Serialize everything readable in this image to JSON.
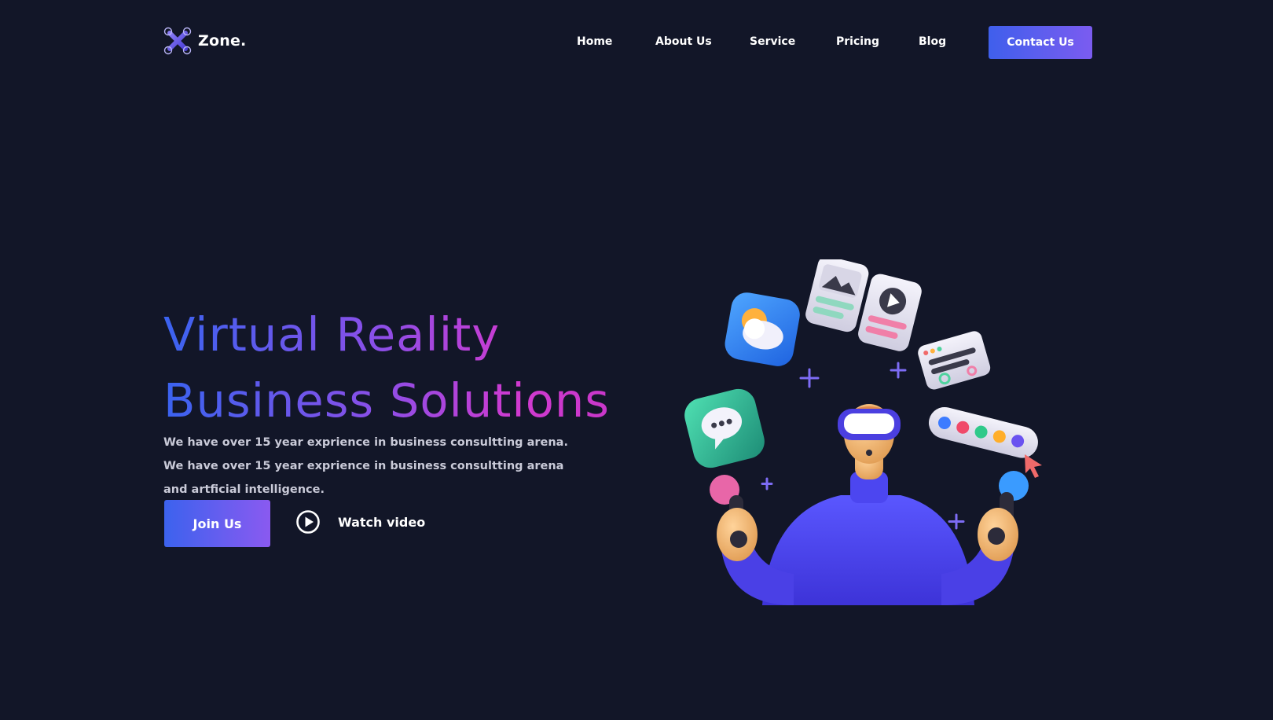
{
  "brand": {
    "name": "Zone.",
    "logo_icon": "drone-x-icon"
  },
  "nav": {
    "items": [
      {
        "label": "Home"
      },
      {
        "label": "About Us"
      },
      {
        "label": "Service"
      },
      {
        "label": "Pricing"
      },
      {
        "label": "Blog"
      }
    ],
    "cta_label": "Contact Us"
  },
  "hero": {
    "title_line1": "Virtual Reality",
    "title_line2": "Business Solutions",
    "description": "We have over 15 year exprience in business consultting arena. We have over 15 year exprience in business consultting arena and artficial intelligence.",
    "primary_button": "Join Us",
    "video_link": "Watch video",
    "video_icon": "play-circle-icon"
  },
  "colors": {
    "background": "#121628",
    "accent_blue": "#3f5fec",
    "accent_purple": "#7b5cf0",
    "accent_magenta": "#d03ad0"
  }
}
